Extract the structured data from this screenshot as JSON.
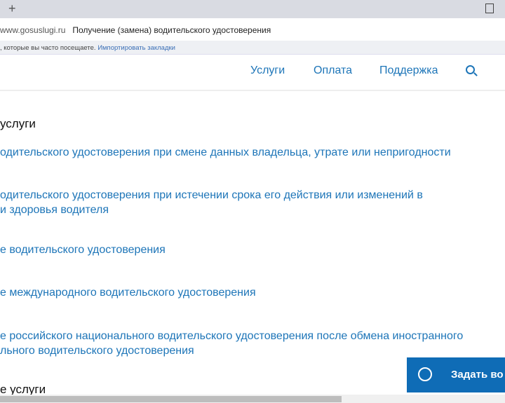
{
  "browser": {
    "url_host": "www.gosuslugi.ru",
    "page_title": "Получение (замена) водительского удостоверения",
    "bookmarks_hint": ", которые вы часто посещаете.",
    "import_bookmarks": "Импортировать закладки"
  },
  "nav": {
    "items": [
      "Услуги",
      "Оплата",
      "Поддержка"
    ]
  },
  "section_title": "услуги",
  "links": [
    "одительского удостоверения при смене данных владельца, утрате или непригодности",
    "одительского удостоверения при истечении срока его действия или изменений в",
    "и здоровья водителя",
    "е водительского удостоверения",
    "е международного водительского удостоверения",
    "е российского национального водительского удостоверения после обмена иностранного",
    "льного водительского удостоверения"
  ],
  "section2_title": "е услуги",
  "ask_button": "Задать во"
}
